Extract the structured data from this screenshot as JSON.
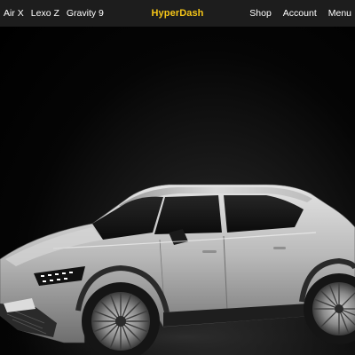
{
  "nav": {
    "left_links": [
      "Air X",
      "Lexo Z",
      "Gravity 9"
    ],
    "brand": "HyperDash",
    "right_links": [
      "Shop",
      "Account",
      "Menu"
    ]
  },
  "colors": {
    "navbar_bg": "#1d1d1d",
    "brand": "#f5c518",
    "nav_text": "#ffffff",
    "hero_bg": "#000000"
  },
  "hero": {
    "image": "silver electric crossover SUV on dark background"
  }
}
